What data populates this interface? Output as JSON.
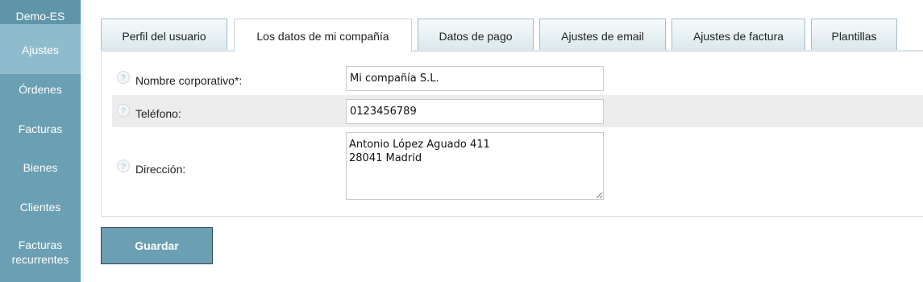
{
  "sidebar": {
    "brand": "Demo-ES",
    "items": [
      {
        "label": "Ajustes"
      },
      {
        "label": "Órdenes"
      },
      {
        "label": "Facturas"
      },
      {
        "label": "Bienes"
      },
      {
        "label": "Clientes"
      },
      {
        "label": "Facturas",
        "label2": "recurrentes"
      }
    ],
    "active_item": "Ajustes"
  },
  "tabs": [
    {
      "label": "Perfil del usuario"
    },
    {
      "label": "Los datos de mi compañía"
    },
    {
      "label": "Datos de pago"
    },
    {
      "label": "Ajustes de email"
    },
    {
      "label": "Ajustes de factura"
    },
    {
      "label": "Plantillas"
    }
  ],
  "active_tab": "Los datos de mi compañía",
  "form": {
    "company_name": {
      "label": "Nombre corporativo*:",
      "value": "Mi compañía S.L."
    },
    "phone": {
      "label": "Teléfono:",
      "value": "0123456789"
    },
    "address": {
      "label": "Dirección:",
      "value": "Antonio López Aguado 411\n28041 Madrid"
    }
  },
  "help_glyph": "?",
  "icons": {
    "help": "help-icon",
    "resize": "resize-grip-icon"
  },
  "save_label": "Guardar",
  "colors": {
    "sidebar": "#6b9fb3",
    "sidebar_active": "#8fbccc",
    "button": "#6b9fb3",
    "button_border": "#2f4a53",
    "shaded_row": "#ececec"
  }
}
